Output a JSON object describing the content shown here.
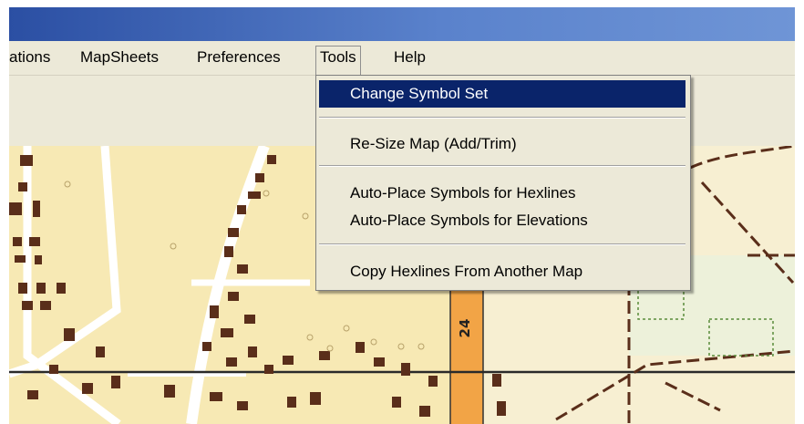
{
  "menubar": {
    "items": [
      {
        "label": "ations"
      },
      {
        "label": "MapSheets"
      },
      {
        "label": "Preferences"
      },
      {
        "label": "Tools"
      },
      {
        "label": "Help"
      }
    ]
  },
  "tools_menu": {
    "items": [
      {
        "label": "Change Symbol Set",
        "selected": true
      },
      {
        "label": "Re-Size Map (Add/Trim)"
      },
      {
        "label": "Auto-Place Symbols for Hexlines"
      },
      {
        "label": "Auto-Place Symbols for Elevations"
      },
      {
        "label": "Copy Hexlines From Another Map"
      }
    ]
  },
  "map": {
    "road_number": "24"
  },
  "colors": {
    "titlebar": "#2b4fa3",
    "menu_background": "#ece9d8",
    "menu_highlight": "#0a246a",
    "map_background": "#f7e9b4"
  }
}
